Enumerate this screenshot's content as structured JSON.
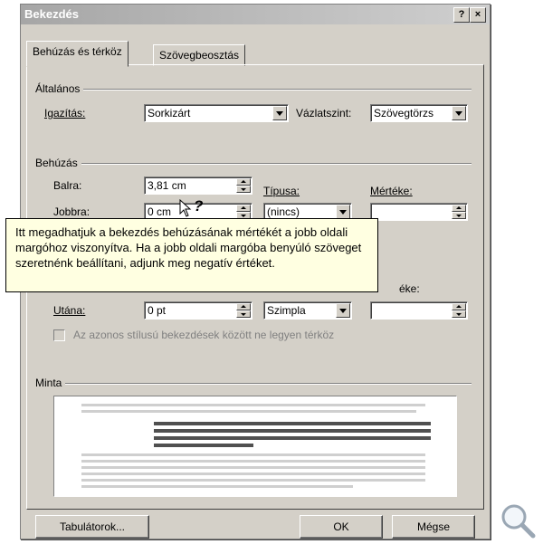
{
  "window": {
    "title": "Bekezdés",
    "help_glyph": "?",
    "close_glyph": "×"
  },
  "tabs": [
    {
      "label": "Behúzás és térköz",
      "active": true
    },
    {
      "label": "Szövegbeosztás",
      "active": false
    }
  ],
  "general": {
    "heading": "Általános",
    "alignment_label": "Igazítás:",
    "alignment_value": "Sorkizárt",
    "outline_label": "Vázlatszint:",
    "outline_value": "Szövegtörzs"
  },
  "indentation": {
    "heading": "Behúzás",
    "left_label": "Balra:",
    "left_value": "3,81 cm",
    "right_label": "Jobbra:",
    "right_value": "0 cm",
    "type_label": "Típusa:",
    "type_value": "(nincs)",
    "measure_label": "Mértéke:",
    "measure_value": ""
  },
  "spacing": {
    "after_label": "Utána:",
    "after_value": "0 pt",
    "line_value": "Szimpla",
    "measure_label_partial": "éke:",
    "measure_value": "",
    "no_space_same_style": "Az azonos stílusú bekezdések között ne legyen térköz"
  },
  "preview": {
    "heading": "Minta"
  },
  "tooltip": {
    "text": "Itt megadhatjuk a bekezdés behúzásának mértékét a jobb oldali margóhoz viszonyítva. Ha a jobb oldali margóba benyúló szöveget szeretnénk beállítani, adjunk meg negatív értéket.",
    "cursor_glyph": "?"
  },
  "buttons": {
    "tabs": "Tabulátorok...",
    "ok": "OK",
    "cancel": "Mégse"
  },
  "icons": {
    "zoom": "magnifier-icon"
  },
  "colors": {
    "dialog_bg": "#d4d0c8",
    "tooltip_bg": "#ffffe1"
  }
}
